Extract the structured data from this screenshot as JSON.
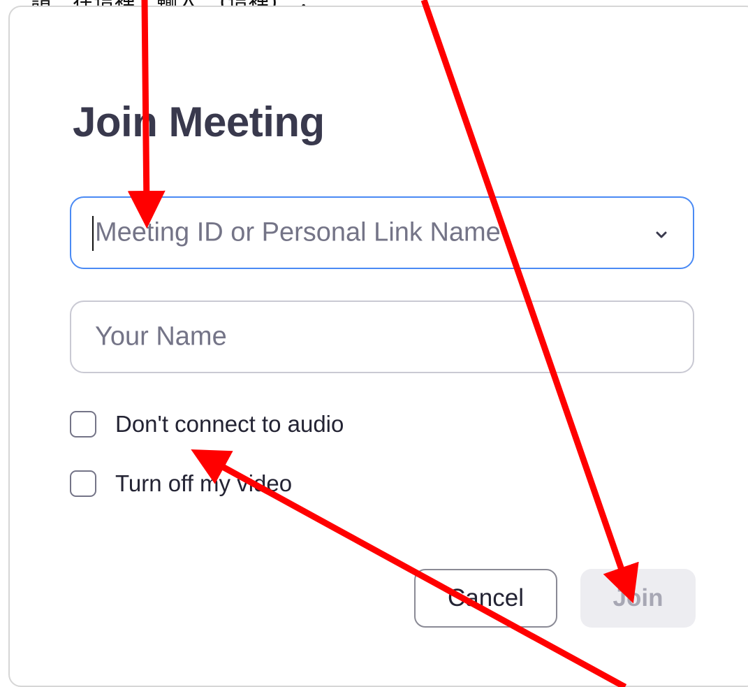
{
  "caption_top": "請…在這裡…輸入…(這裡)…，",
  "dialog": {
    "title": "Join Meeting",
    "meeting_id_placeholder": "Meeting ID or Personal Link Name",
    "name_placeholder": "Your Name",
    "options": [
      {
        "label": "Don't connect to audio",
        "checked": false
      },
      {
        "label": "Turn off my video",
        "checked": false
      }
    ],
    "cancel_label": "Cancel",
    "join_label": "Join"
  },
  "colors": {
    "focus_border": "#4a8af4",
    "annotation_arrow": "#ff0000",
    "join_disabled_bg": "#ededf1"
  },
  "icons": {
    "dropdown": "chevron-down-icon"
  }
}
